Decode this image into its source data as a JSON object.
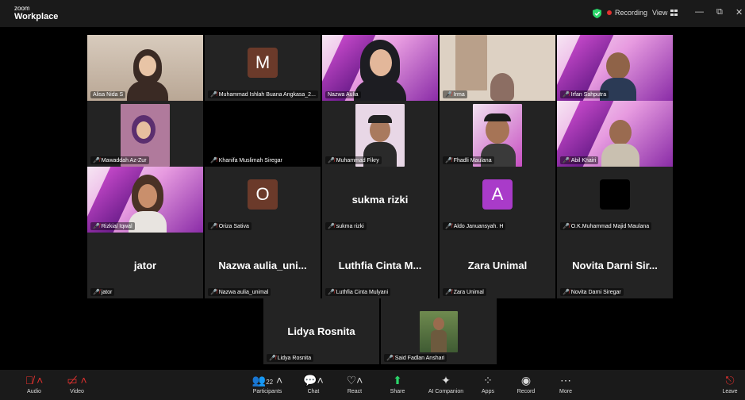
{
  "app": {
    "logo_line1": "zoom",
    "logo_line2": "Workplace"
  },
  "topbar": {
    "recording_label": "Recording",
    "view_label": "View",
    "minimize": "—",
    "maximize": "⧉",
    "close": "✕"
  },
  "participants": [
    {
      "name": "Alisa Nida S"
    },
    {
      "name": "Muhammad Ishlah Buana Angkasa_2..."
    },
    {
      "name": "Nazwa Aulia"
    },
    {
      "name": "Irma"
    },
    {
      "name": "Irfan Sahputra"
    },
    {
      "name": "Mawaddah Az-Zur"
    },
    {
      "name": "Khanifa Muslimah Siregar"
    },
    {
      "name": "Muhammad Fikry"
    },
    {
      "name": "Fhadli Maulana"
    },
    {
      "name": "Abil Khairi"
    },
    {
      "name": "Rizkial Iqwal"
    },
    {
      "name": "Oriza Sativa"
    },
    {
      "name": "sukma rizki",
      "display": "sukma rizki"
    },
    {
      "name": "Aldo Januansyah. H"
    },
    {
      "name": "O.K.Muhammad Majid Maulana"
    },
    {
      "name": "jator",
      "display": "jator"
    },
    {
      "name": "Nazwa aulia_unimal",
      "display": "Nazwa  aulia_uni..."
    },
    {
      "name": "Luthfia Cinta Mulyani",
      "display": "Luthfia Cinta M..."
    },
    {
      "name": "Zara Unimal",
      "display": "Zara Unimal"
    },
    {
      "name": "Novita Darni Siregar",
      "display": "Novita Darni Sir..."
    },
    {
      "name": "Lidya Rosnita",
      "display": "Lidya Rosnita"
    },
    {
      "name": "Said Fadlan Anshari"
    }
  ],
  "avatars": {
    "m": "M",
    "o": "O",
    "a": "A"
  },
  "colors": {
    "avatar_m": "#6b3a2a",
    "avatar_o": "#6b3a2a",
    "avatar_a": "#a93bc9",
    "active_border": "#2bd66a",
    "recording": "#e0312f"
  },
  "toolbar": {
    "audio": "Audio",
    "video": "Video",
    "participants": "Participants",
    "participants_count": "22",
    "chat": "Chat",
    "react": "React",
    "share": "Share",
    "ai": "AI Companion",
    "apps": "Apps",
    "record": "Record",
    "more": "More",
    "leave": "Leave"
  }
}
